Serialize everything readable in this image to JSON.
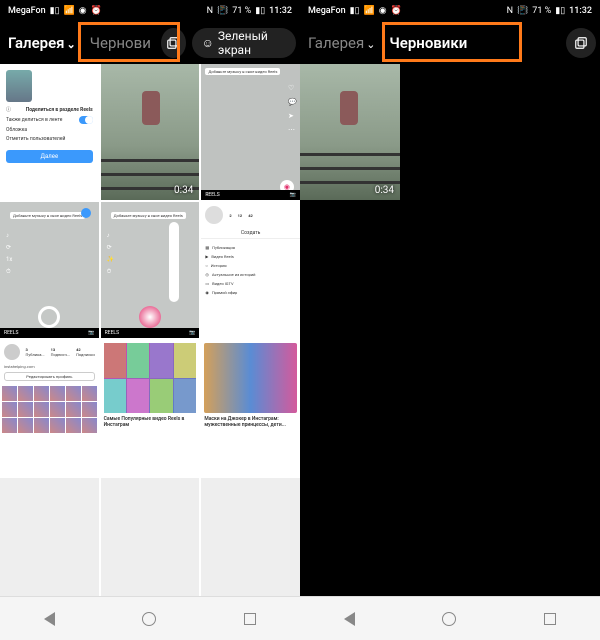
{
  "status": {
    "carrier": "MegaFon",
    "nfc": "N",
    "battery_pct": "71 %",
    "time": "11:32"
  },
  "left": {
    "tabs": {
      "gallery": "Галерея",
      "drafts": "Чернови",
      "green": "Зеленый экран"
    },
    "items": [
      {
        "kind": "share",
        "duration": "",
        "share_title": "Поделиться в разделе Reels",
        "also": "Также делиться в ленте",
        "cover": "Обложка",
        "tag": "Отметить пользователей",
        "btn": "Далее"
      },
      {
        "kind": "kid",
        "duration": "0:34"
      },
      {
        "kind": "reelsui",
        "duration": "",
        "label": "Добавьте музыку в свое видео Reels",
        "bot": "REELS"
      },
      {
        "kind": "reels2",
        "duration": "",
        "label": "Добавьте музыку в свое видео Reels",
        "bot": "REELS"
      },
      {
        "kind": "reels2b",
        "duration": "",
        "label": "Добавьте музыку в свое видео Reels",
        "bot": "REELS"
      },
      {
        "kind": "profile",
        "duration": "",
        "stats": [
          "2",
          "12",
          "42"
        ],
        "hdr": "Создать",
        "menu": [
          "Публикация",
          "Видео Reels",
          "История",
          "Актуальное из историй",
          "Видео IGTV",
          "Прямой эфир"
        ]
      },
      {
        "kind": "grid",
        "duration": "",
        "stats": [
          "3",
          "13",
          "42"
        ],
        "statlbl": [
          "Публика...",
          "Подписч...",
          "Подписки"
        ],
        "bio": "instahelping.com",
        "eb": "Редактировать профиль"
      },
      {
        "kind": "article1",
        "duration": "",
        "title": "Самые Популярные видео Reels в Инстаграм"
      },
      {
        "kind": "article2",
        "duration": "",
        "title": "Маски на Джокер в Инстаграм: мужественные принцессы, дети..."
      }
    ]
  },
  "right": {
    "tabs": {
      "gallery": "Галерея",
      "drafts": "Черновики"
    },
    "draft_duration": "0:34"
  }
}
